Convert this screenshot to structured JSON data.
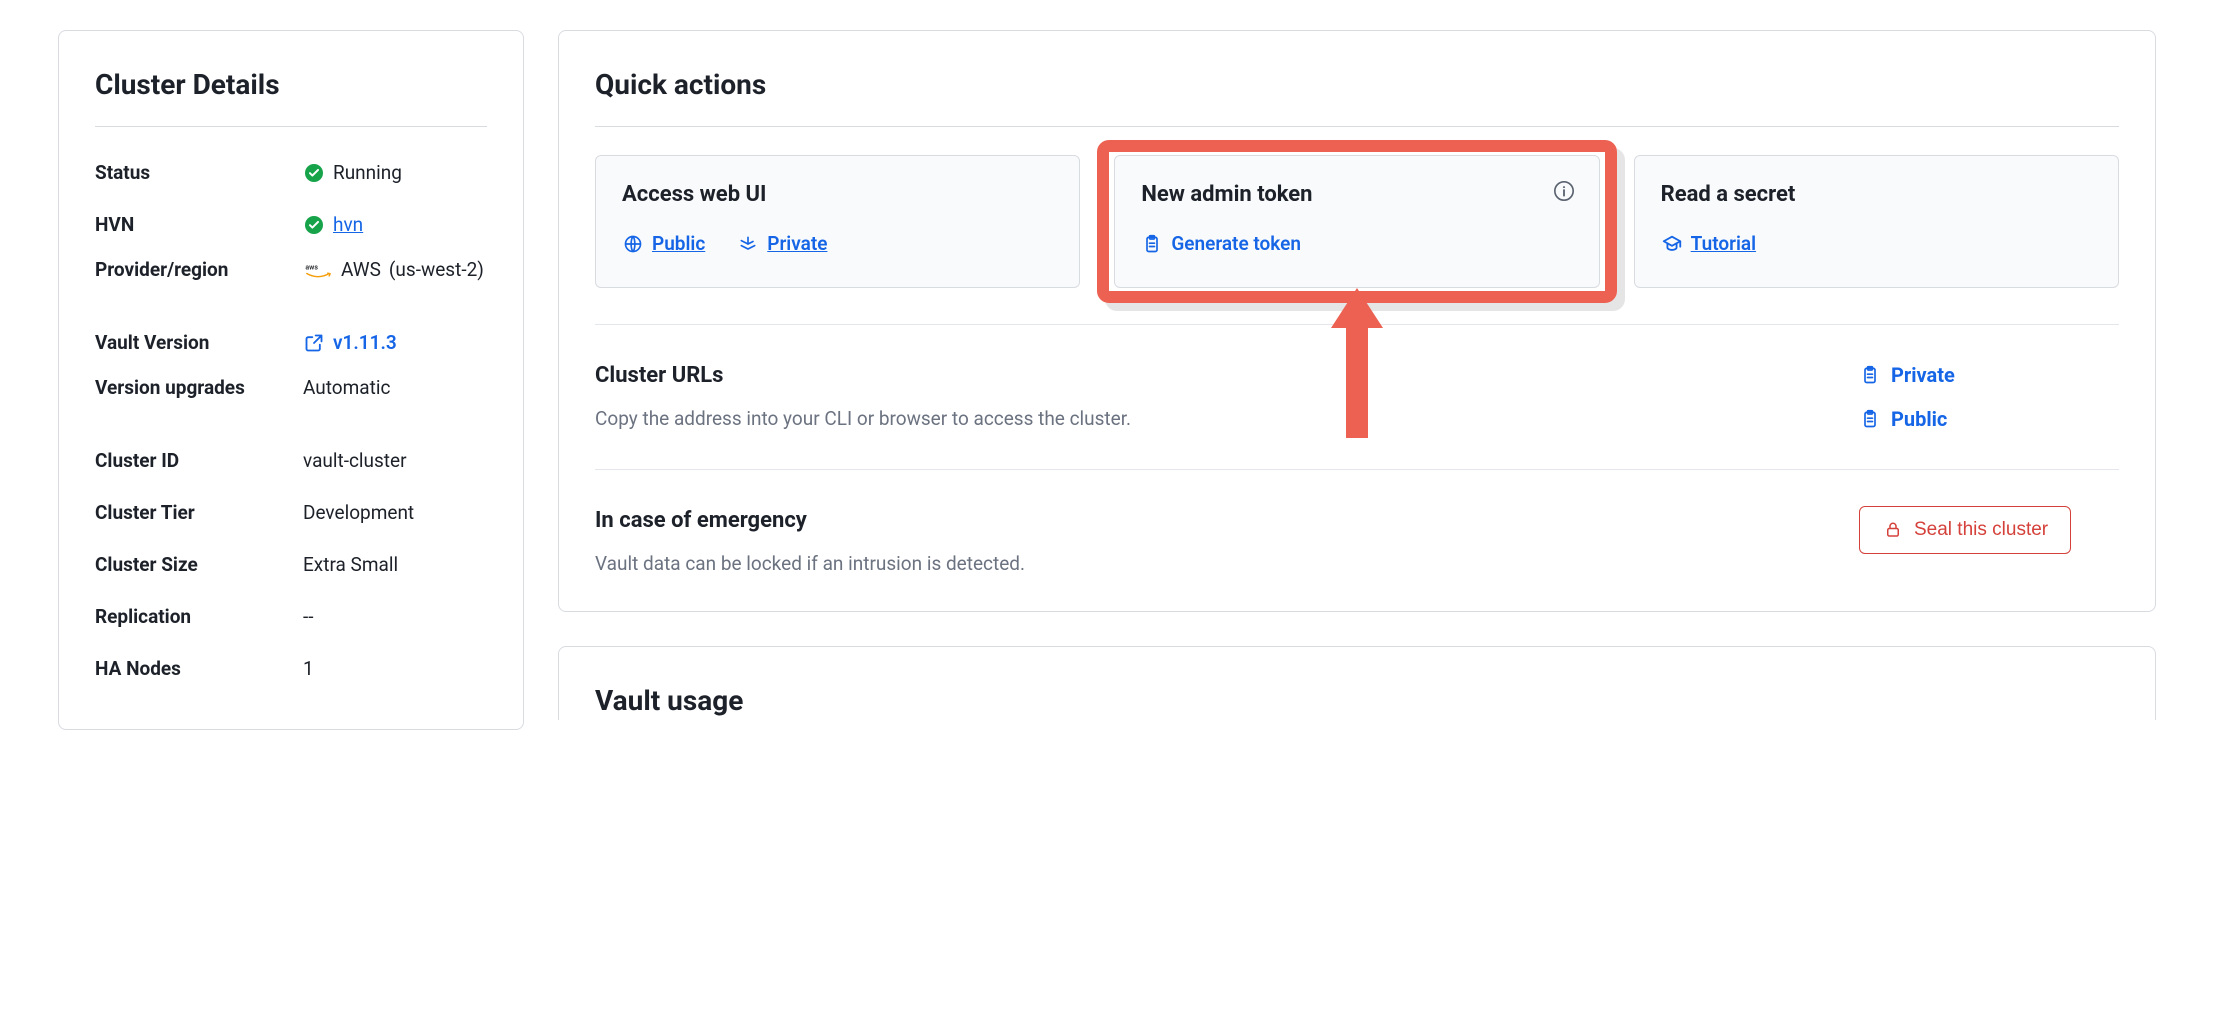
{
  "clusterDetails": {
    "title": "Cluster Details",
    "rows": {
      "status": {
        "label": "Status",
        "value": "Running"
      },
      "hvn": {
        "label": "HVN",
        "value": "hvn"
      },
      "provider": {
        "label": "Provider/region",
        "name": "AWS",
        "region": "(us-west-2)"
      },
      "version": {
        "label": "Vault Version",
        "value": "v1.11.3"
      },
      "upgrades": {
        "label": "Version upgrades",
        "value": "Automatic"
      },
      "clusterId": {
        "label": "Cluster ID",
        "value": "vault-cluster"
      },
      "tier": {
        "label": "Cluster Tier",
        "value": "Development"
      },
      "size": {
        "label": "Cluster Size",
        "value": "Extra Small"
      },
      "replication": {
        "label": "Replication",
        "value": "--"
      },
      "haNodes": {
        "label": "HA Nodes",
        "value": "1"
      }
    }
  },
  "quickActions": {
    "title": "Quick actions",
    "accessWeb": {
      "title": "Access web UI",
      "public": "Public",
      "private": "Private"
    },
    "adminToken": {
      "title": "New admin token",
      "action": "Generate token"
    },
    "readSecret": {
      "title": "Read a secret",
      "action": "Tutorial"
    },
    "clusterUrls": {
      "title": "Cluster URLs",
      "desc": "Copy the address into your CLI or browser to access the cluster.",
      "private": "Private",
      "public": "Public"
    },
    "emergency": {
      "title": "In case of emergency",
      "desc": "Vault data can be locked if an intrusion is detected.",
      "button": "Seal this cluster"
    }
  },
  "vaultUsage": {
    "title": "Vault usage"
  }
}
